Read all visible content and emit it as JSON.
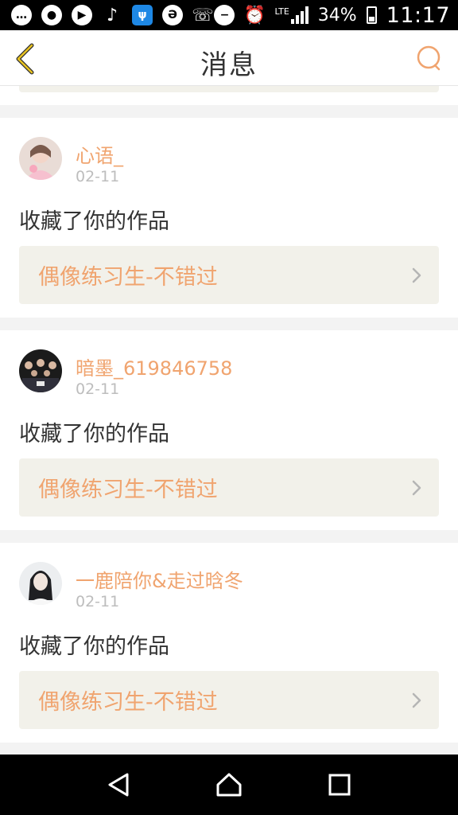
{
  "status_bar": {
    "battery": "34%",
    "time": "11:17",
    "network": "LTE"
  },
  "header": {
    "title": "消息",
    "back_icon": "chevron-left-icon",
    "action_icon": "chat-bubble-icon",
    "accent_color": "#f0a46f"
  },
  "messages": [
    {
      "username": "心语_",
      "date": "02-11",
      "action": "收藏了你的作品",
      "work_title": "偶像练习生-不错过"
    },
    {
      "username": "暗墨_619846758",
      "date": "02-11",
      "action": "收藏了你的作品",
      "work_title": "偶像练习生-不错过"
    },
    {
      "username": "一鹿陪你&走过晗冬",
      "date": "02-11",
      "action": "收藏了你的作品",
      "work_title": "偶像练习生-不错过"
    }
  ]
}
